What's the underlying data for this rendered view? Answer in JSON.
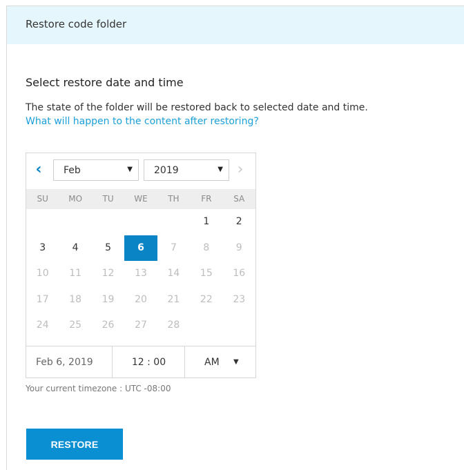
{
  "panel": {
    "title": "Restore code folder"
  },
  "section": {
    "heading": "Select restore date and time",
    "description": "The state of the folder will be restored back to selected date and time.",
    "help_link": "What will happen to the content after restoring?"
  },
  "calendar": {
    "month": "Feb",
    "year": "2019",
    "weekdays": [
      "SU",
      "MO",
      "TU",
      "WE",
      "TH",
      "FR",
      "SA"
    ],
    "selected_day": "6",
    "weeks": [
      [
        {
          "d": "",
          "s": "empty"
        },
        {
          "d": "",
          "s": "empty"
        },
        {
          "d": "",
          "s": "empty"
        },
        {
          "d": "",
          "s": "empty"
        },
        {
          "d": "",
          "s": "empty"
        },
        {
          "d": "1",
          "s": "enabled"
        },
        {
          "d": "2",
          "s": "enabled"
        }
      ],
      [
        {
          "d": "3",
          "s": "enabled"
        },
        {
          "d": "4",
          "s": "enabled"
        },
        {
          "d": "5",
          "s": "enabled"
        },
        {
          "d": "6",
          "s": "selected"
        },
        {
          "d": "7",
          "s": "disabled"
        },
        {
          "d": "8",
          "s": "disabled"
        },
        {
          "d": "9",
          "s": "disabled"
        }
      ],
      [
        {
          "d": "10",
          "s": "disabled"
        },
        {
          "d": "11",
          "s": "disabled"
        },
        {
          "d": "12",
          "s": "disabled"
        },
        {
          "d": "13",
          "s": "disabled"
        },
        {
          "d": "14",
          "s": "disabled"
        },
        {
          "d": "15",
          "s": "disabled"
        },
        {
          "d": "16",
          "s": "disabled"
        }
      ],
      [
        {
          "d": "17",
          "s": "disabled"
        },
        {
          "d": "18",
          "s": "disabled"
        },
        {
          "d": "19",
          "s": "disabled"
        },
        {
          "d": "20",
          "s": "disabled"
        },
        {
          "d": "21",
          "s": "disabled"
        },
        {
          "d": "22",
          "s": "disabled"
        },
        {
          "d": "23",
          "s": "disabled"
        }
      ],
      [
        {
          "d": "24",
          "s": "disabled"
        },
        {
          "d": "25",
          "s": "disabled"
        },
        {
          "d": "26",
          "s": "disabled"
        },
        {
          "d": "27",
          "s": "disabled"
        },
        {
          "d": "28",
          "s": "disabled"
        },
        {
          "d": "",
          "s": "empty"
        },
        {
          "d": "",
          "s": "empty"
        }
      ]
    ],
    "selected_date_text": "Feb 6, 2019",
    "time_value": "12 : 00",
    "ampm": "AM"
  },
  "timezone_text": "Your current timezone : UTC -08:00",
  "restore_button_label": "RESTORE",
  "icons": {
    "prev": "chevron-left-icon",
    "next": "chevron-right-icon",
    "dropdown": "caret-down-icon"
  },
  "colors": {
    "header_bg": "#e5f6fc",
    "accent": "#0b84c6",
    "link": "#1a9fd8",
    "button": "#0b8fd3"
  }
}
